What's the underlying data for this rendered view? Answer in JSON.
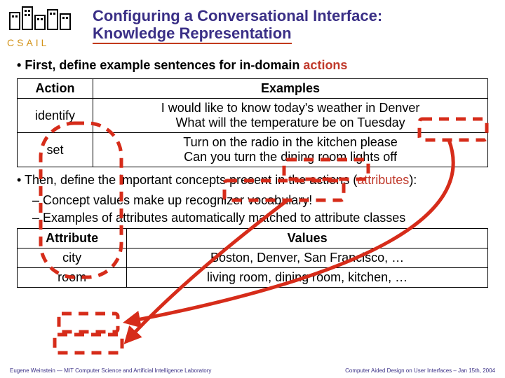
{
  "header": {
    "logo_label": "CSAIL",
    "title_line1": "Configuring a Conversational Interface:",
    "title_line2": "Knowledge Representation"
  },
  "bullets": {
    "b1_prefix": "First, define example sentences for in-domain ",
    "b1_actions": "actions",
    "b2_prefix": "Then, define the important concepts present in the actions (",
    "b2_attributes": "attributes",
    "b2_suffix": "):",
    "sub1": "Concept values make up recognizer vocabulary!",
    "sub2": "Examples of attributes automatically matched to attribute classes"
  },
  "table1": {
    "h1": "Action",
    "h2": "Examples",
    "rows": [
      {
        "action": "identify",
        "ex1": "I would like to know today's weather in Denver",
        "ex2": "What will the temperature be on Tuesday"
      },
      {
        "action": "set",
        "ex1": "Turn on the radio in the kitchen please",
        "ex2": "Can you turn the dining room lights off"
      }
    ]
  },
  "table2": {
    "h1": "Attribute",
    "h2": "Values",
    "rows": [
      {
        "attr": "city",
        "vals": "Boston, Denver, San Francisco, …"
      },
      {
        "attr": "room",
        "vals": "living room, dining room, kitchen, …"
      }
    ]
  },
  "footer": {
    "left": "Eugene Weinstein — MIT Computer Science and Artificial Intelligence Laboratory",
    "right": "Computer Aided Design on User Interfaces – Jan 15th, 2004"
  }
}
